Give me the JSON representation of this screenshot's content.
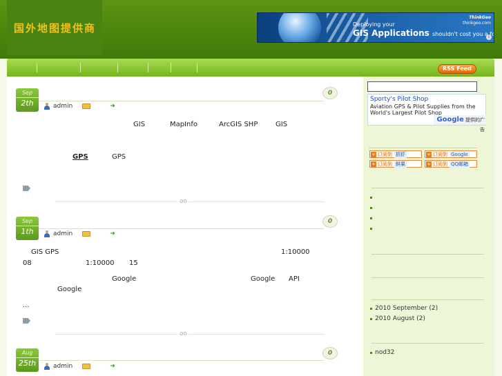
{
  "header": {
    "site_title": "国外地图提供商",
    "banner": {
      "small": "Deploying your",
      "big": "GIS Applications",
      "tail": "shouldn't cost you a fortune",
      "brand": "ThinkGeo",
      "brand_url": "thinkgeo.com",
      "info": "i"
    }
  },
  "nav": {
    "rss_label": "RSS Feed"
  },
  "posts": [
    {
      "month": "Sep",
      "day": "2th",
      "comments": "0",
      "author": "admin",
      "lines": [
        "GIS",
        "MapInfo",
        "ArcGIS SHP",
        "GIS",
        "GPS",
        "GPS"
      ]
    },
    {
      "month": "Sep",
      "day": "1th",
      "comments": "0",
      "author": "admin",
      "lines": [
        "GIS GPS",
        "1:10000",
        "08",
        "1:10000",
        "15",
        "Google",
        "Google",
        "API",
        "Google",
        "..."
      ]
    },
    {
      "month": "Aug",
      "day": "25th",
      "comments": "0",
      "author": "admin"
    }
  ],
  "divider_mark": "oo",
  "sidebar": {
    "search": {
      "placeholder": ""
    },
    "ad": {
      "title": "Sporty's Pilot Shop",
      "text": "Aviation GPS & Pilot Supplies from the World's Largest Pilot Shop",
      "footer_brand": "Google",
      "footer_text": "提供的广告"
    },
    "subscribe": [
      {
        "prefix": "订阅到",
        "service": "抓虾"
      },
      {
        "prefix": "订阅到",
        "service": "Google"
      },
      {
        "prefix": "订阅到",
        "service": "鲜果"
      },
      {
        "prefix": "订阅到",
        "service": "QQ邮箱"
      }
    ],
    "archives": [
      "2010 September (2)",
      "2010 August (2)"
    ],
    "links": [
      "nod32"
    ]
  },
  "colors": {
    "accent_green": "#74b41e",
    "header_green": "#4a8410",
    "title_yellow": "#f0c020",
    "rss_orange": "#f08a24"
  },
  "icons": [
    "user-icon",
    "folder-icon",
    "arrow-right-icon",
    "tag-icon",
    "plus-icon"
  ]
}
